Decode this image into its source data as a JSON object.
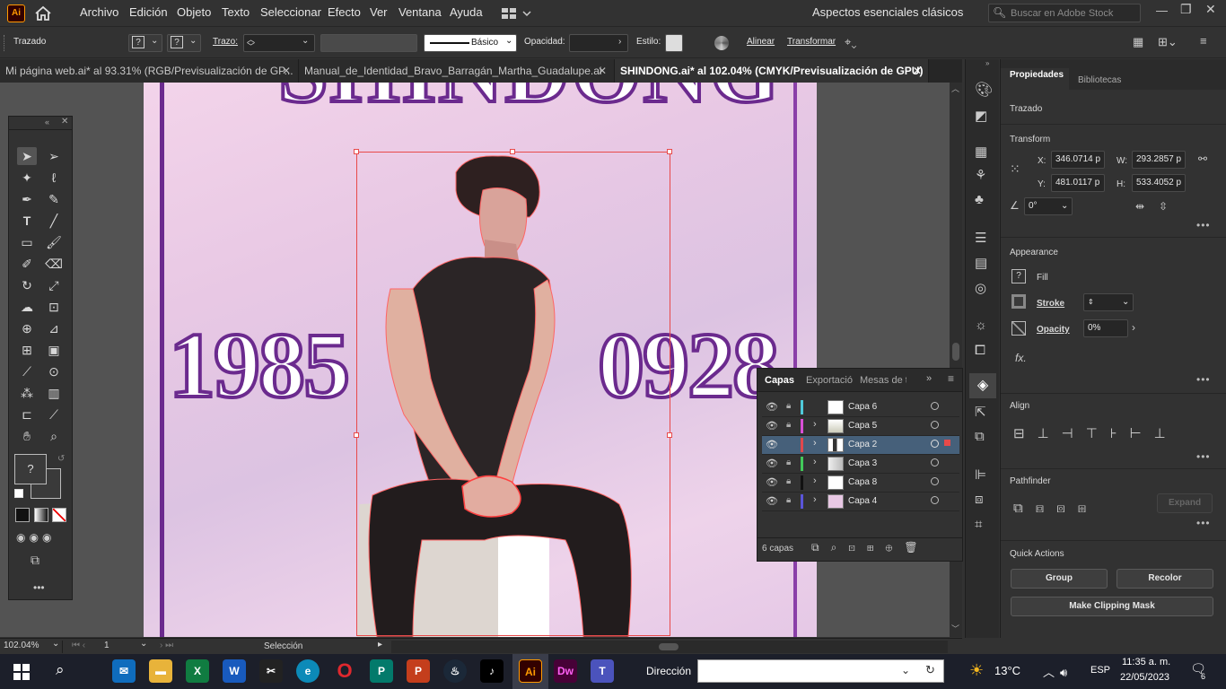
{
  "menubar": {
    "app_icon": "Ai",
    "items": [
      "Archivo",
      "Edición",
      "Objeto",
      "Texto",
      "Seleccionar",
      "Efecto",
      "Ver",
      "Ventana",
      "Ayuda"
    ],
    "workspace": "Aspectos esenciales clásicos",
    "search_placeholder": "Buscar en Adobe Stock"
  },
  "control_bar": {
    "selection_type": "Trazado",
    "stroke_label": "Trazo:",
    "brush_label": "Básico",
    "opacity_label": "Opacidad:",
    "style_label": "Estilo:",
    "align_label": "Alinear",
    "transform_label": "Transformar"
  },
  "tabs": [
    {
      "label": "Mi página web.ai* al 93.31% (RGB/Previsualización de GP...",
      "active": false
    },
    {
      "label": "Manual_de_Identidad_Bravo_Barragán_Martha_Guadalupe.ai",
      "active": false
    },
    {
      "label": "SHINDONG.ai* al 102.04% (CMYK/Previsualización de GPU)",
      "active": true
    }
  ],
  "artwork": {
    "title": "SHINDONG",
    "left_number": "1985",
    "right_number": "0928"
  },
  "layers_panel": {
    "tabs": [
      "Capas",
      "Exportació",
      "Mesas de tr"
    ],
    "layers": [
      {
        "name": "Capa 6",
        "color": "#4fc9d9",
        "selected": false
      },
      {
        "name": "Capa 5",
        "color": "#d94fd6",
        "selected": false
      },
      {
        "name": "Capa 2",
        "color": "#e0484d",
        "selected": true
      },
      {
        "name": "Capa 3",
        "color": "#42c95a",
        "selected": false
      },
      {
        "name": "Capa 8",
        "color": "#111111",
        "selected": false
      },
      {
        "name": "Capa 4",
        "color": "#5a55d9",
        "selected": false
      }
    ],
    "count": "6 capas"
  },
  "properties": {
    "tabs": [
      "Propiedades",
      "Bibliotecas"
    ],
    "selection": "Trazado",
    "transform_title": "Transform",
    "x_label": "X:",
    "x": "346.0714 p",
    "y_label": "Y:",
    "y": "481.0117 p",
    "w_label": "W:",
    "w": "293.2857 p",
    "h_label": "H:",
    "h": "533.4052 p",
    "angle": "0°",
    "appearance_title": "Appearance",
    "fill_label": "Fill",
    "stroke_label": "Stroke",
    "opacity_label": "Opacity",
    "opacity": "0%",
    "fx": "fx.",
    "align_title": "Align",
    "pathfinder_title": "Pathfinder",
    "expand": "Expand",
    "quick_actions_title": "Quick Actions",
    "group": "Group",
    "recolor": "Recolor",
    "clipping_mask": "Make Clipping Mask"
  },
  "status": {
    "zoom": "102.04%",
    "artboard": "1",
    "tool": "Selección"
  },
  "taskbar": {
    "address_label": "Dirección",
    "temperature": "13°C",
    "language": "ESP",
    "time": "11:35 a. m.",
    "date": "22/05/2023",
    "notifications": "6",
    "apps": [
      "Mail",
      "Explorer",
      "Excel",
      "Word",
      "CapCut",
      "Edge",
      "Opera",
      "Publisher",
      "PowerPoint",
      "Steam",
      "TikTok",
      "Ai",
      "Dw",
      "Teams"
    ]
  },
  "colors": {
    "accent_purple": "#6b2a8e",
    "selection_red": "#e84a4a",
    "selected_row": "#46607a",
    "ai_orange": "#ff9a00"
  }
}
